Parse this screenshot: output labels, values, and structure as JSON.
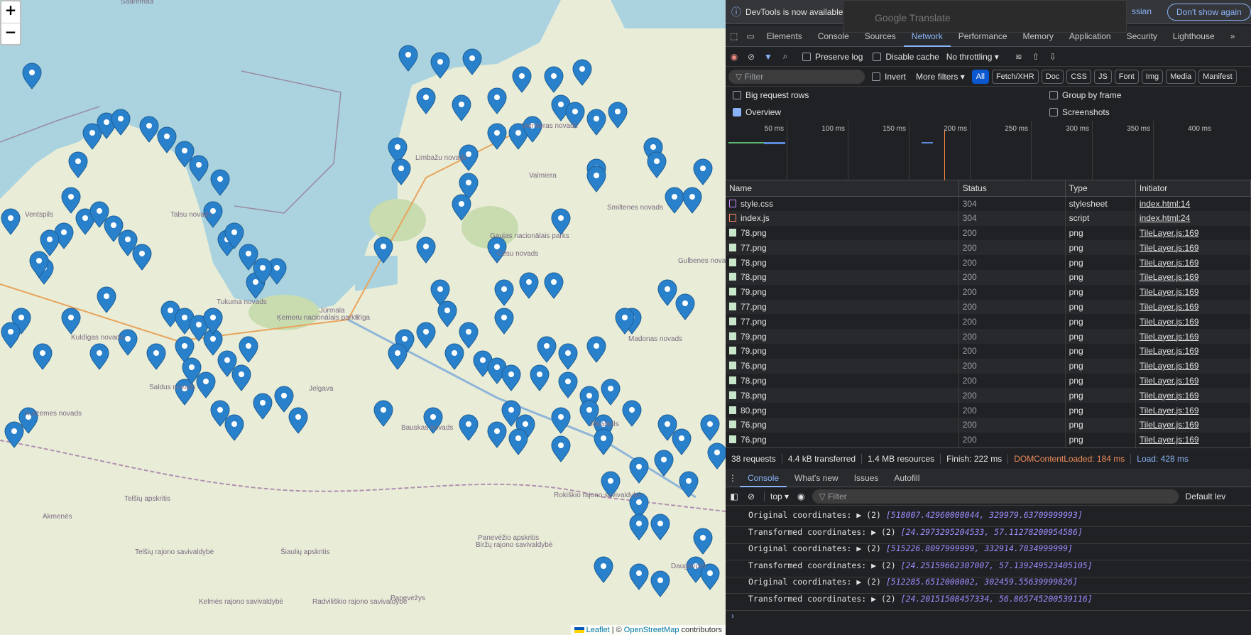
{
  "map": {
    "zoom_in": "+",
    "zoom_out": "−",
    "attribution_leaflet": "Leaflet",
    "attribution_osm": "OpenStreetMap",
    "attribution_sep": "| ©",
    "attribution_tail": "contributors",
    "labels": [
      "Saaremaa",
      "Ventspils",
      "Talsu novads",
      "Kuldīgas novads",
      "Saldus novads",
      "Tukuma novads",
      "Jūrmala",
      "Rīga",
      "Ķemeru nacionālais parks",
      "Jelgava",
      "Bauskas novads",
      "Limbažu novads",
      "Valmieras novads",
      "Valmiera",
      "Gaujas nacionālais parks",
      "Cēsu novads",
      "Smiltenes novads",
      "Gulbenes novads",
      "Madonas novads",
      "Jēkabpils",
      "Daugavpils",
      "Panevėžys",
      "Biržų rajono savivaldybė",
      "Rokiškio rajono savivaldybė",
      "Panevėžio apskritis",
      "Šiaulių apskritis",
      "Telšių apskritis",
      "Kelmės rajono savivaldybė",
      "Radviliškio rajono savivaldybė",
      "Telšių rajono savivaldybė",
      "Akmenės",
      "Kurzemes novads"
    ],
    "marker_color": "#2a81cb"
  },
  "devtools": {
    "infobar_text": "DevTools is now available",
    "infobar_lang_btn": "ssian",
    "infobar_dismiss": "Don't show again",
    "translate_popup": "Google Translate",
    "tabs": [
      "Elements",
      "Console",
      "Sources",
      "Network",
      "Performance",
      "Memory",
      "Application",
      "Security",
      "Lighthouse"
    ],
    "toolbar": {
      "preserve_log": "Preserve log",
      "disable_cache": "Disable cache",
      "throttling": "No throttling"
    },
    "filter_placeholder": "Filter",
    "invert": "Invert",
    "more_filters": "More filters",
    "type_chips": [
      "All",
      "Fetch/XHR",
      "Doc",
      "CSS",
      "JS",
      "Font",
      "Img",
      "Media",
      "Manifest"
    ],
    "options": {
      "big_rows": "Big request rows",
      "group_by_frame": "Group by frame",
      "overview": "Overview",
      "screenshots": "Screenshots"
    },
    "ticks": [
      "50 ms",
      "100 ms",
      "150 ms",
      "200 ms",
      "250 ms",
      "300 ms",
      "350 ms",
      "400 ms"
    ],
    "columns": [
      "Name",
      "Status",
      "Type",
      "Initiator"
    ],
    "requests": [
      {
        "name": "style.css",
        "status": "304",
        "type": "stylesheet",
        "initiator": "index.html:14",
        "kind": "css"
      },
      {
        "name": "index.js",
        "status": "304",
        "type": "script",
        "initiator": "index.html:24",
        "kind": "js"
      },
      {
        "name": "78.png",
        "status": "200",
        "type": "png",
        "initiator": "TileLayer.js:169",
        "kind": "img"
      },
      {
        "name": "77.png",
        "status": "200",
        "type": "png",
        "initiator": "TileLayer.js:169",
        "kind": "img"
      },
      {
        "name": "78.png",
        "status": "200",
        "type": "png",
        "initiator": "TileLayer.js:169",
        "kind": "img"
      },
      {
        "name": "78.png",
        "status": "200",
        "type": "png",
        "initiator": "TileLayer.js:169",
        "kind": "img"
      },
      {
        "name": "79.png",
        "status": "200",
        "type": "png",
        "initiator": "TileLayer.js:169",
        "kind": "img"
      },
      {
        "name": "77.png",
        "status": "200",
        "type": "png",
        "initiator": "TileLayer.js:169",
        "kind": "img"
      },
      {
        "name": "77.png",
        "status": "200",
        "type": "png",
        "initiator": "TileLayer.js:169",
        "kind": "img"
      },
      {
        "name": "79.png",
        "status": "200",
        "type": "png",
        "initiator": "TileLayer.js:169",
        "kind": "img"
      },
      {
        "name": "79.png",
        "status": "200",
        "type": "png",
        "initiator": "TileLayer.js:169",
        "kind": "img"
      },
      {
        "name": "76.png",
        "status": "200",
        "type": "png",
        "initiator": "TileLayer.js:169",
        "kind": "img"
      },
      {
        "name": "78.png",
        "status": "200",
        "type": "png",
        "initiator": "TileLayer.js:169",
        "kind": "img"
      },
      {
        "name": "78.png",
        "status": "200",
        "type": "png",
        "initiator": "TileLayer.js:169",
        "kind": "img"
      },
      {
        "name": "80.png",
        "status": "200",
        "type": "png",
        "initiator": "TileLayer.js:169",
        "kind": "img"
      },
      {
        "name": "76.png",
        "status": "200",
        "type": "png",
        "initiator": "TileLayer.js:169",
        "kind": "img"
      },
      {
        "name": "76.png",
        "status": "200",
        "type": "png",
        "initiator": "TileLayer.js:169",
        "kind": "img"
      }
    ],
    "summary": {
      "requests": "38 requests",
      "transferred": "4.4 kB transferred",
      "resources": "1.4 MB resources",
      "finish": "Finish: 222 ms",
      "dcl": "DOMContentLoaded: 184 ms",
      "load": "Load: 428 ms"
    },
    "drawer_tabs": [
      "Console",
      "What's new",
      "Issues",
      "Autofill"
    ],
    "console_context": "top",
    "console_filter": "Filter",
    "console_level": "Default lev",
    "logs": [
      {
        "label": "Original coordinates:",
        "prefix": "▶ (2) ",
        "value": "[518007.42960000044, 329979.63709999993]"
      },
      {
        "label": "Transformed coordinates:",
        "prefix": "▶ (2) ",
        "value": "[24.2973295204533, 57.11278200954586]"
      },
      {
        "label": "Original coordinates:",
        "prefix": "▶ (2) ",
        "value": "[515226.8097999999, 332914.7834999999]"
      },
      {
        "label": "Transformed coordinates:",
        "prefix": "▶ (2) ",
        "value": "[24.25159662307007, 57.139249523405105]"
      },
      {
        "label": "Original coordinates:",
        "prefix": "▶ (2) ",
        "value": "[512285.6512000002, 302459.55639999826]"
      },
      {
        "label": "Transformed coordinates:",
        "prefix": "▶ (2) ",
        "value": "[24.20151508457334, 56.865745200539116]"
      }
    ]
  }
}
